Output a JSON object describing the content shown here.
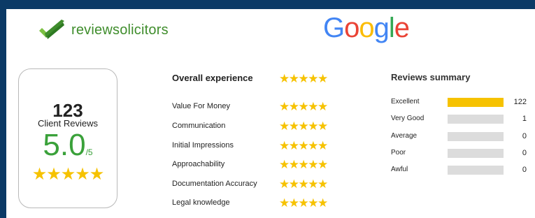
{
  "brand": {
    "name": "reviewsolicitors"
  },
  "google": {
    "letters": [
      "G",
      "o",
      "o",
      "g",
      "l",
      "e"
    ],
    "colors": [
      "#4285F4",
      "#EA4335",
      "#FBBC05",
      "#4285F4",
      "#34A853",
      "#EA4335"
    ]
  },
  "summary": {
    "count": "123",
    "label": "Client Reviews",
    "rating": "5.0",
    "out_of": "/5",
    "stars": 5
  },
  "categories": [
    {
      "label": "Overall experience",
      "stars": 5
    },
    {
      "label": "Value For Money",
      "stars": 5
    },
    {
      "label": "Communication",
      "stars": 5
    },
    {
      "label": "Initial Impressions",
      "stars": 5
    },
    {
      "label": "Approachability",
      "stars": 5
    },
    {
      "label": "Documentation Accuracy",
      "stars": 5
    },
    {
      "label": "Legal knowledge",
      "stars": 5
    }
  ],
  "reviews_summary": {
    "title": "Reviews summary",
    "rows": [
      {
        "label": "Excellent",
        "count": "122",
        "fill": 1.0
      },
      {
        "label": "Very Good",
        "count": "1",
        "fill": 0.0
      },
      {
        "label": "Average",
        "count": "0",
        "fill": 0.0
      },
      {
        "label": "Poor",
        "count": "0",
        "fill": 0.0
      },
      {
        "label": "Awful",
        "count": "0",
        "fill": 0.0
      }
    ]
  },
  "colors": {
    "star": "#f6c200",
    "brand_green": "#3f8d2c",
    "rating_green": "#3aa13a",
    "bar_fill": "#f6c200",
    "bar_track": "#dcdcdc",
    "border": "#0b3a66"
  }
}
